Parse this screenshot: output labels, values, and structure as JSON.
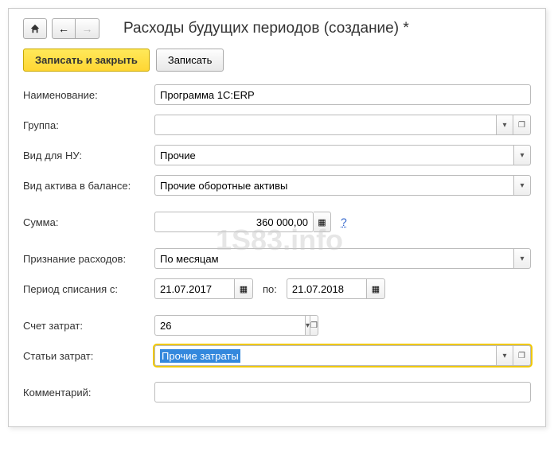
{
  "header": {
    "title": "Расходы будущих периодов (создание) *"
  },
  "toolbar": {
    "save_close": "Записать и закрыть",
    "save": "Записать"
  },
  "fields": {
    "name": {
      "label": "Наименование:",
      "value": "Программа 1С:ERP"
    },
    "group": {
      "label": "Группа:",
      "value": ""
    },
    "nu_type": {
      "label": "Вид для НУ:",
      "value": "Прочие"
    },
    "asset_type": {
      "label": "Вид актива в балансе:",
      "value": "Прочие оборотные активы"
    },
    "amount": {
      "label": "Сумма:",
      "value": "360 000,00",
      "help": "?"
    },
    "recognition": {
      "label": "Признание расходов:",
      "value": "По месяцам"
    },
    "period": {
      "label": "Период списания с:",
      "from": "21.07.2017",
      "to_label": "по:",
      "to": "21.07.2018"
    },
    "account": {
      "label": "Счет затрат:",
      "value": "26"
    },
    "cost_item": {
      "label": "Статьи затрат:",
      "value": "Прочие затраты"
    },
    "comment": {
      "label": "Комментарий:",
      "value": ""
    }
  },
  "icons": {
    "dropdown": "▾",
    "open": "❐",
    "calc": "▦",
    "calendar": "▦"
  },
  "watermark": "1S83.info"
}
